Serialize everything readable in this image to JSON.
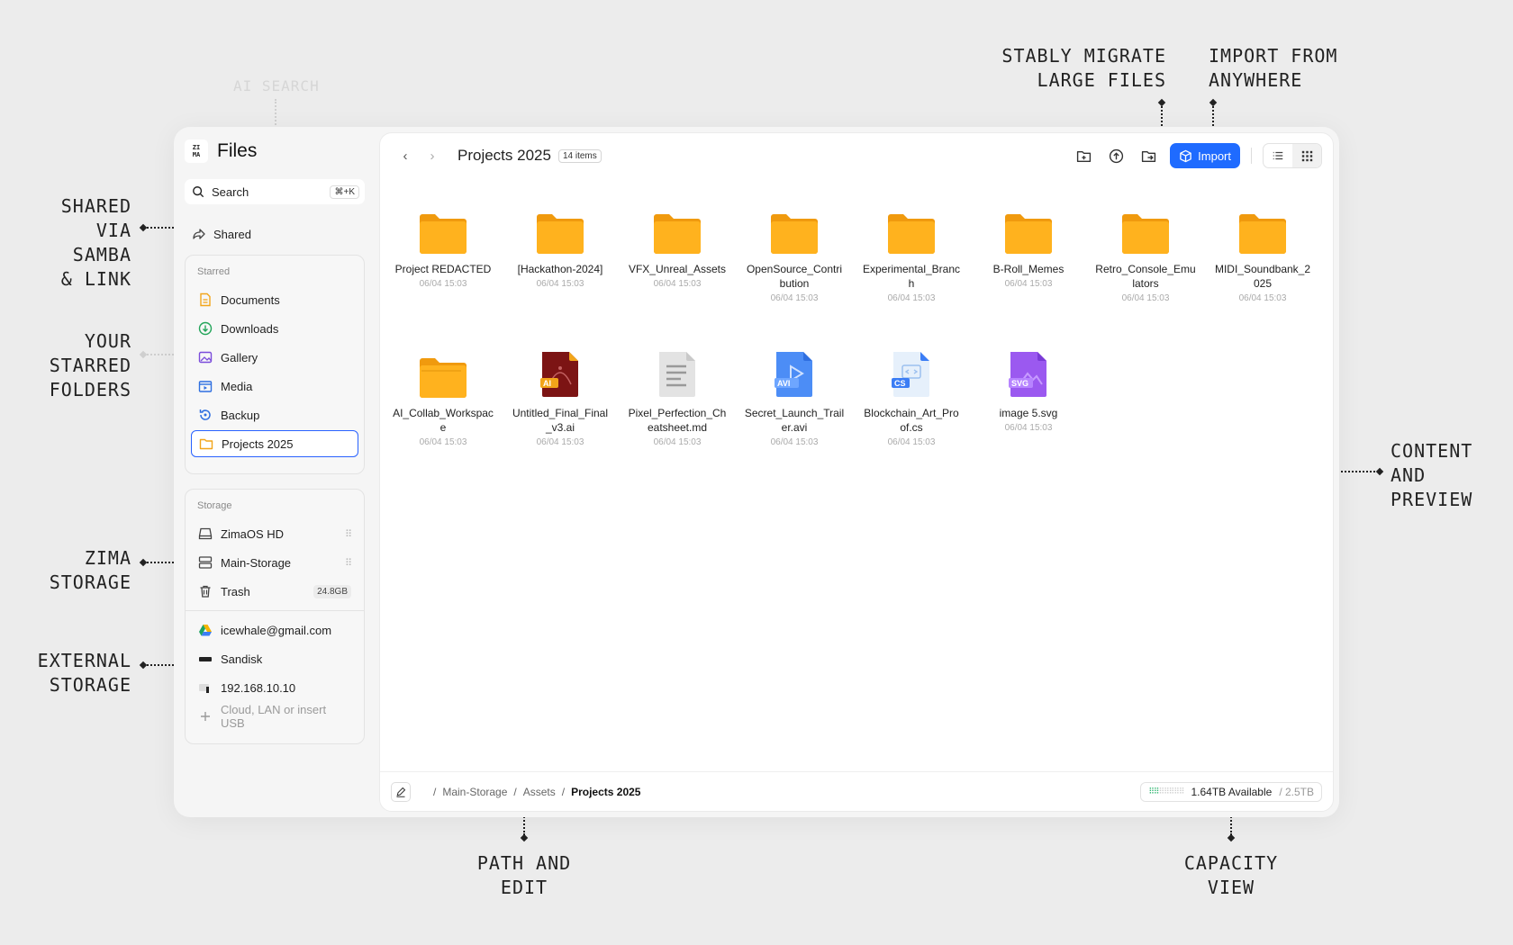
{
  "callouts": {
    "ai_search": "AI SEARCH",
    "shared": "SHARED\nVIA\nSAMBA\n& LINK",
    "starred": "YOUR\nSTARRED\nFOLDERS",
    "zima": "ZIMA\nSTORAGE",
    "external": "EXTERNAL\nSTORAGE",
    "migrate": "STABLY MIGRATE\nLARGE FILES",
    "import": "IMPORT FROM\nANYWHERE",
    "content": "CONTENT\nAND\nPREVIEW",
    "path": "PATH AND\nEDIT",
    "capacity": "CAPACITY\nVIEW"
  },
  "app": {
    "logo": "ZI\nMA",
    "title": "Files"
  },
  "search": {
    "label": "Search",
    "shortcut": "⌘+K"
  },
  "shared": {
    "label": "Shared"
  },
  "starred": {
    "title": "Starred",
    "items": [
      {
        "label": "Documents",
        "icon": "document-icon",
        "color": "#f2a51a"
      },
      {
        "label": "Downloads",
        "icon": "download-icon",
        "color": "#23a55a"
      },
      {
        "label": "Gallery",
        "icon": "gallery-icon",
        "color": "#7b4ddb"
      },
      {
        "label": "Media",
        "icon": "media-icon",
        "color": "#2f6fe0"
      },
      {
        "label": "Backup",
        "icon": "backup-icon",
        "color": "#2f6fe0"
      },
      {
        "label": "Projects 2025",
        "icon": "folder-icon",
        "color": "#f2a51a"
      }
    ]
  },
  "storage": {
    "title": "Storage",
    "items": [
      {
        "label": "ZimaOS HD",
        "icon": "drive-icon"
      },
      {
        "label": "Main-Storage",
        "icon": "server-icon"
      },
      {
        "label": "Trash",
        "icon": "trash-icon",
        "tag": "24.8GB"
      }
    ],
    "external": [
      {
        "label": "icewhale@gmail.com",
        "icon": "google-drive-icon"
      },
      {
        "label": "Sandisk",
        "icon": "usb-drive-icon"
      },
      {
        "label": "192.168.10.10",
        "icon": "network-drive-icon"
      }
    ],
    "add_label": "Cloud, LAN or insert USB"
  },
  "toolbar": {
    "folder_title": "Projects 2025",
    "item_count": "14 items",
    "import_label": "Import"
  },
  "files": [
    {
      "name": "Project REDACTED",
      "date": "06/04 15:03",
      "type": "folder"
    },
    {
      "name": "[Hackathon-2024]",
      "date": "06/04 15:03",
      "type": "folder"
    },
    {
      "name": "VFX_Unreal_Assets",
      "date": "06/04 15:03",
      "type": "folder"
    },
    {
      "name": "OpenSource_Contribution",
      "date": "06/04 15:03",
      "type": "folder"
    },
    {
      "name": "Experimental_Branch",
      "date": "06/04 15:03",
      "type": "folder"
    },
    {
      "name": "B-Roll_Memes",
      "date": "06/04 15:03",
      "type": "folder"
    },
    {
      "name": "Retro_Console_Emulators",
      "date": "06/04 15:03",
      "type": "folder"
    },
    {
      "name": "MIDI_Soundbank_2025",
      "date": "06/04 15:03",
      "type": "folder"
    },
    {
      "name": "AI_Collab_Workspace",
      "date": "06/04 15:03",
      "type": "folder-open"
    },
    {
      "name": "Untitled_Final_Final_v3.ai",
      "date": "06/04 15:03",
      "type": "ai",
      "badge": "AI"
    },
    {
      "name": "Pixel_Perfection_Cheatsheet.md",
      "date": "06/04 15:03",
      "type": "md"
    },
    {
      "name": "Secret_Launch_Trailer.avi",
      "date": "06/04 15:03",
      "type": "avi",
      "badge": "AVI"
    },
    {
      "name": "Blockchain_Art_Proof.cs",
      "date": "06/04 15:03",
      "type": "cs",
      "badge": "CS"
    },
    {
      "name": "image 5.svg",
      "date": "06/04 15:03",
      "type": "svg",
      "badge": "SVG"
    }
  ],
  "breadcrumb": [
    "Main-Storage",
    "Assets",
    "Projects 2025"
  ],
  "capacity": {
    "available": "1.64TB Available",
    "total": "/ 2.5TB"
  }
}
